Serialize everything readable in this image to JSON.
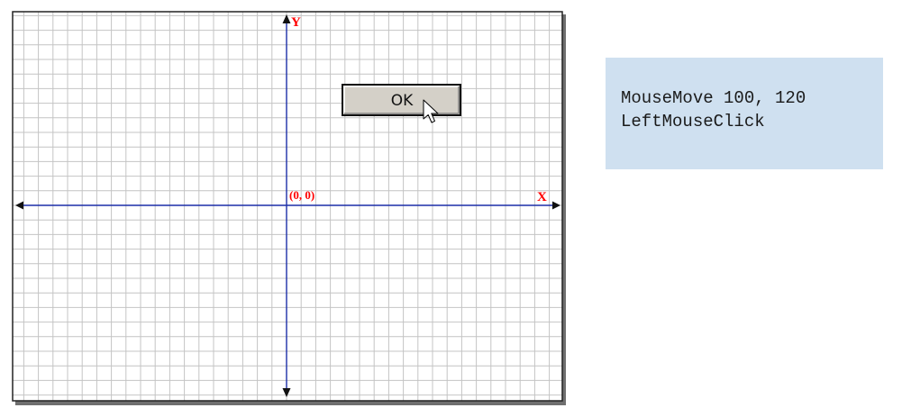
{
  "diagram": {
    "y_axis_label": "Y",
    "x_axis_label": "X",
    "origin_label": "(0, 0)",
    "ok_button_label": "OK",
    "colors": {
      "grid": "#c4c4c4",
      "axis": "#1c2fa8",
      "axis_label": "#ff0000",
      "button_face": "#d4d0c8",
      "border": "#222222"
    },
    "icons": [
      "arrow-cursor-icon",
      "arrowhead-icon"
    ]
  },
  "code_panel": {
    "lines": [
      "MouseMove 100, 120",
      "LeftMouseClick"
    ],
    "background": "#cfe0f0"
  }
}
